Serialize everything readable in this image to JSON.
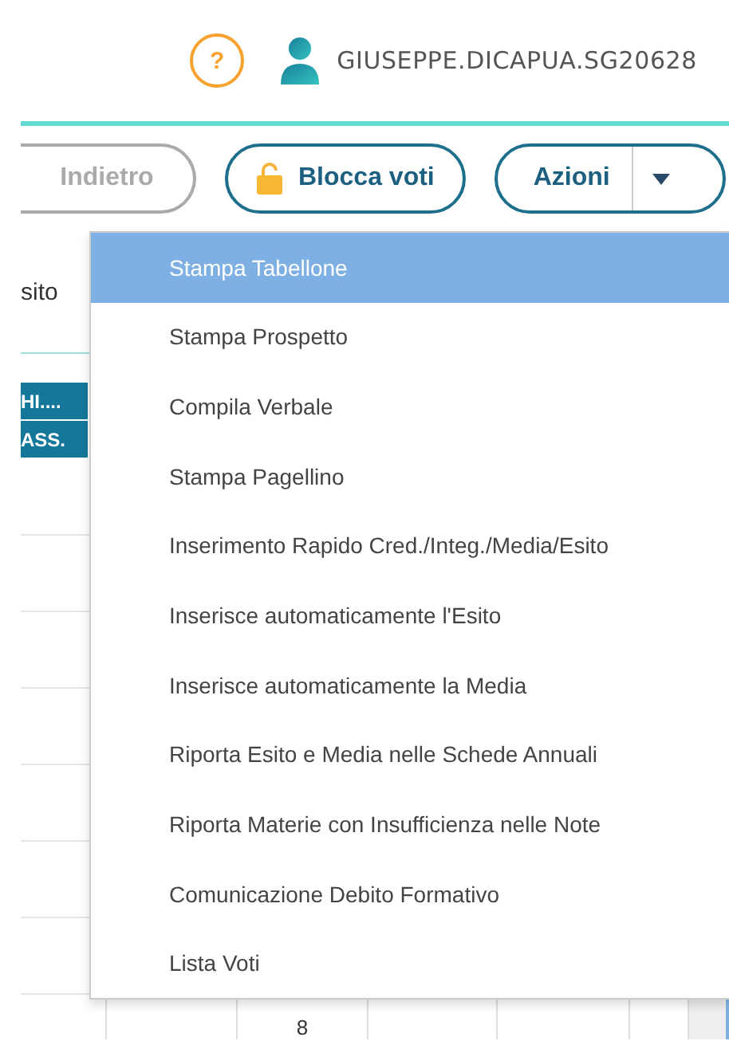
{
  "header": {
    "help": "?",
    "user_name": "GIUSEPPE.DICAPUA.SG20628"
  },
  "toolbar": {
    "buttons": [
      {
        "kind": "back",
        "label": "Indietro",
        "disabled": true
      },
      {
        "kind": "lock",
        "label": "Blocca voti",
        "disabled": false
      },
      {
        "kind": "split",
        "label": "Azioni",
        "disabled": false
      }
    ]
  },
  "table": {
    "column_header": "sito",
    "header_cells": [
      "HI....",
      "ASS."
    ],
    "bottom_row_value": "8"
  },
  "menu": {
    "items": [
      {
        "label": "Stampa Tabellone",
        "selected": true
      },
      {
        "label": "Stampa Prospetto",
        "selected": false
      },
      {
        "label": "Compila Verbale",
        "selected": false
      },
      {
        "label": "Stampa Pagellino",
        "selected": false
      },
      {
        "label": "Inserimento Rapido Cred./Integ./Media/Esito",
        "selected": false
      },
      {
        "label": "Inserisce automaticamente l'Esito",
        "selected": false
      },
      {
        "label": "Inserisce automaticamente la Media",
        "selected": false
      },
      {
        "label": "Riporta Esito e Media nelle Schede Annuali",
        "selected": false
      },
      {
        "label": "Riporta Materie con Insufficienza nelle Note",
        "selected": false
      },
      {
        "label": "Comunicazione Debito Formativo",
        "selected": false
      },
      {
        "label": "Lista Voti",
        "selected": false
      }
    ]
  }
}
